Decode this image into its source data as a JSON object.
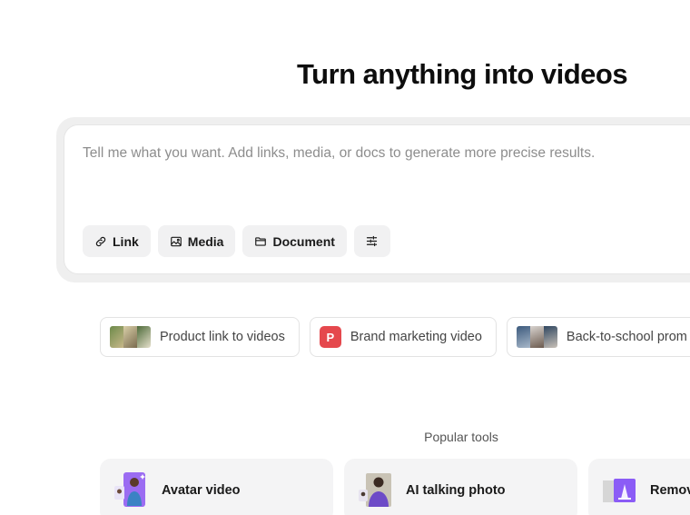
{
  "headline": "Turn anything into videos",
  "composer": {
    "placeholder": "Tell me what you want. Add links, media, or docs to generate more precise results.",
    "value": "",
    "chips": {
      "link": "Link",
      "media": "Media",
      "document": "Document"
    }
  },
  "suggestions": [
    {
      "label": "Product link to videos",
      "icon": "product-thumbnail"
    },
    {
      "label": "Brand marketing video",
      "icon": "p-badge",
      "badge": "P"
    },
    {
      "label": "Back-to-school prom",
      "icon": "people-thumbnail"
    }
  ],
  "popular_tools": {
    "title": "Popular tools",
    "items": [
      {
        "label": "Avatar video",
        "icon": "avatar-thumbnail"
      },
      {
        "label": "AI talking photo",
        "icon": "talking-photo-thumbnail"
      },
      {
        "label": "Remov",
        "icon": "remove-thumbnail"
      }
    ]
  },
  "colors": {
    "accent_purple": "#8b5cf6",
    "badge_red": "#e5484d"
  }
}
